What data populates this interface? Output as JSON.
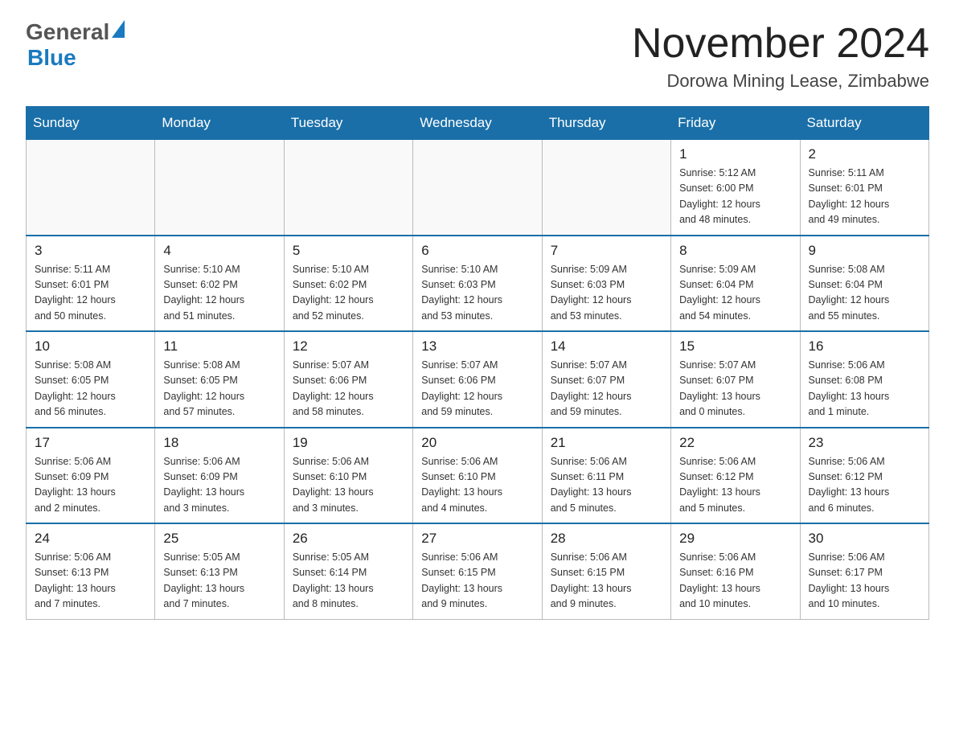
{
  "header": {
    "logo_general": "General",
    "logo_blue": "Blue",
    "month_title": "November 2024",
    "subtitle": "Dorowa Mining Lease, Zimbabwe"
  },
  "weekdays": [
    "Sunday",
    "Monday",
    "Tuesday",
    "Wednesday",
    "Thursday",
    "Friday",
    "Saturday"
  ],
  "weeks": [
    {
      "days": [
        {
          "number": "",
          "info": ""
        },
        {
          "number": "",
          "info": ""
        },
        {
          "number": "",
          "info": ""
        },
        {
          "number": "",
          "info": ""
        },
        {
          "number": "",
          "info": ""
        },
        {
          "number": "1",
          "info": "Sunrise: 5:12 AM\nSunset: 6:00 PM\nDaylight: 12 hours\nand 48 minutes."
        },
        {
          "number": "2",
          "info": "Sunrise: 5:11 AM\nSunset: 6:01 PM\nDaylight: 12 hours\nand 49 minutes."
        }
      ]
    },
    {
      "days": [
        {
          "number": "3",
          "info": "Sunrise: 5:11 AM\nSunset: 6:01 PM\nDaylight: 12 hours\nand 50 minutes."
        },
        {
          "number": "4",
          "info": "Sunrise: 5:10 AM\nSunset: 6:02 PM\nDaylight: 12 hours\nand 51 minutes."
        },
        {
          "number": "5",
          "info": "Sunrise: 5:10 AM\nSunset: 6:02 PM\nDaylight: 12 hours\nand 52 minutes."
        },
        {
          "number": "6",
          "info": "Sunrise: 5:10 AM\nSunset: 6:03 PM\nDaylight: 12 hours\nand 53 minutes."
        },
        {
          "number": "7",
          "info": "Sunrise: 5:09 AM\nSunset: 6:03 PM\nDaylight: 12 hours\nand 53 minutes."
        },
        {
          "number": "8",
          "info": "Sunrise: 5:09 AM\nSunset: 6:04 PM\nDaylight: 12 hours\nand 54 minutes."
        },
        {
          "number": "9",
          "info": "Sunrise: 5:08 AM\nSunset: 6:04 PM\nDaylight: 12 hours\nand 55 minutes."
        }
      ]
    },
    {
      "days": [
        {
          "number": "10",
          "info": "Sunrise: 5:08 AM\nSunset: 6:05 PM\nDaylight: 12 hours\nand 56 minutes."
        },
        {
          "number": "11",
          "info": "Sunrise: 5:08 AM\nSunset: 6:05 PM\nDaylight: 12 hours\nand 57 minutes."
        },
        {
          "number": "12",
          "info": "Sunrise: 5:07 AM\nSunset: 6:06 PM\nDaylight: 12 hours\nand 58 minutes."
        },
        {
          "number": "13",
          "info": "Sunrise: 5:07 AM\nSunset: 6:06 PM\nDaylight: 12 hours\nand 59 minutes."
        },
        {
          "number": "14",
          "info": "Sunrise: 5:07 AM\nSunset: 6:07 PM\nDaylight: 12 hours\nand 59 minutes."
        },
        {
          "number": "15",
          "info": "Sunrise: 5:07 AM\nSunset: 6:07 PM\nDaylight: 13 hours\nand 0 minutes."
        },
        {
          "number": "16",
          "info": "Sunrise: 5:06 AM\nSunset: 6:08 PM\nDaylight: 13 hours\nand 1 minute."
        }
      ]
    },
    {
      "days": [
        {
          "number": "17",
          "info": "Sunrise: 5:06 AM\nSunset: 6:09 PM\nDaylight: 13 hours\nand 2 minutes."
        },
        {
          "number": "18",
          "info": "Sunrise: 5:06 AM\nSunset: 6:09 PM\nDaylight: 13 hours\nand 3 minutes."
        },
        {
          "number": "19",
          "info": "Sunrise: 5:06 AM\nSunset: 6:10 PM\nDaylight: 13 hours\nand 3 minutes."
        },
        {
          "number": "20",
          "info": "Sunrise: 5:06 AM\nSunset: 6:10 PM\nDaylight: 13 hours\nand 4 minutes."
        },
        {
          "number": "21",
          "info": "Sunrise: 5:06 AM\nSunset: 6:11 PM\nDaylight: 13 hours\nand 5 minutes."
        },
        {
          "number": "22",
          "info": "Sunrise: 5:06 AM\nSunset: 6:12 PM\nDaylight: 13 hours\nand 5 minutes."
        },
        {
          "number": "23",
          "info": "Sunrise: 5:06 AM\nSunset: 6:12 PM\nDaylight: 13 hours\nand 6 minutes."
        }
      ]
    },
    {
      "days": [
        {
          "number": "24",
          "info": "Sunrise: 5:06 AM\nSunset: 6:13 PM\nDaylight: 13 hours\nand 7 minutes."
        },
        {
          "number": "25",
          "info": "Sunrise: 5:05 AM\nSunset: 6:13 PM\nDaylight: 13 hours\nand 7 minutes."
        },
        {
          "number": "26",
          "info": "Sunrise: 5:05 AM\nSunset: 6:14 PM\nDaylight: 13 hours\nand 8 minutes."
        },
        {
          "number": "27",
          "info": "Sunrise: 5:06 AM\nSunset: 6:15 PM\nDaylight: 13 hours\nand 9 minutes."
        },
        {
          "number": "28",
          "info": "Sunrise: 5:06 AM\nSunset: 6:15 PM\nDaylight: 13 hours\nand 9 minutes."
        },
        {
          "number": "29",
          "info": "Sunrise: 5:06 AM\nSunset: 6:16 PM\nDaylight: 13 hours\nand 10 minutes."
        },
        {
          "number": "30",
          "info": "Sunrise: 5:06 AM\nSunset: 6:17 PM\nDaylight: 13 hours\nand 10 minutes."
        }
      ]
    }
  ]
}
